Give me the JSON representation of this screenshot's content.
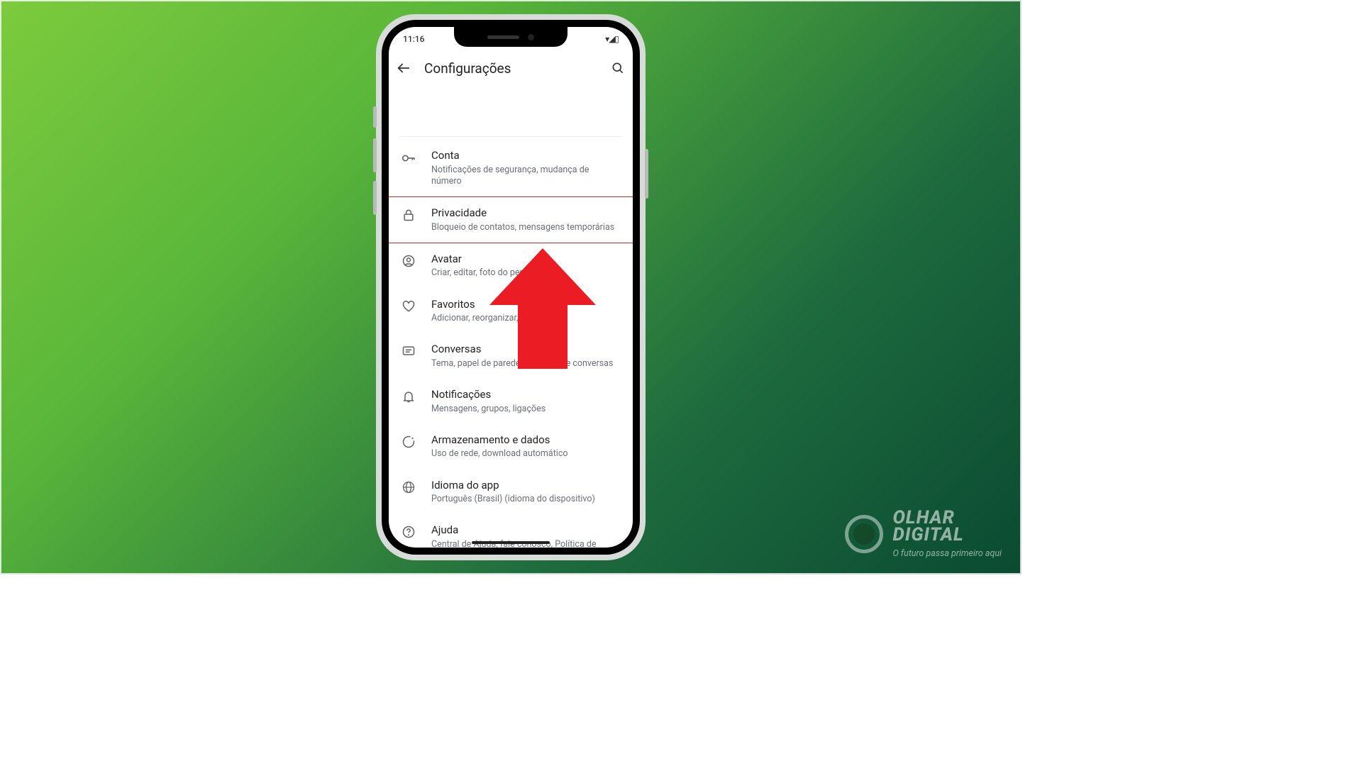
{
  "status": {
    "time": "11:16",
    "right_glyphs": "▾◢▯"
  },
  "header": {
    "title": "Configurações"
  },
  "items": [
    {
      "icon": "key",
      "title": "Conta",
      "sub": "Notificações de segurança, mudança de número",
      "hl": false
    },
    {
      "icon": "lock",
      "title": "Privacidade",
      "sub": "Bloqueio de contatos, mensagens temporárias",
      "hl": true
    },
    {
      "icon": "avatar",
      "title": "Avatar",
      "sub": "Criar, editar, foto do perfil",
      "hl": false
    },
    {
      "icon": "heart",
      "title": "Favoritos",
      "sub": "Adicionar, reorganizar, remover",
      "hl": false
    },
    {
      "icon": "chat",
      "title": "Conversas",
      "sub": "Tema, papel de parede, histórico de conversas",
      "hl": false
    },
    {
      "icon": "bell",
      "title": "Notificações",
      "sub": "Mensagens, grupos, ligações",
      "hl": false
    },
    {
      "icon": "storage",
      "title": "Armazenamento e dados",
      "sub": "Uso de rede, download automático",
      "hl": false
    },
    {
      "icon": "globe",
      "title": "Idioma do app",
      "sub": "Português (Brasil) (idioma do dispositivo)",
      "hl": false
    },
    {
      "icon": "help",
      "title": "Ajuda",
      "sub": "Central de Ajuda, fale conosco, Política de",
      "hl": false
    }
  ],
  "watermark": {
    "line1": "OLHAR",
    "line2": "DIGITAL",
    "tag": "O futuro passa primeiro aqui"
  }
}
